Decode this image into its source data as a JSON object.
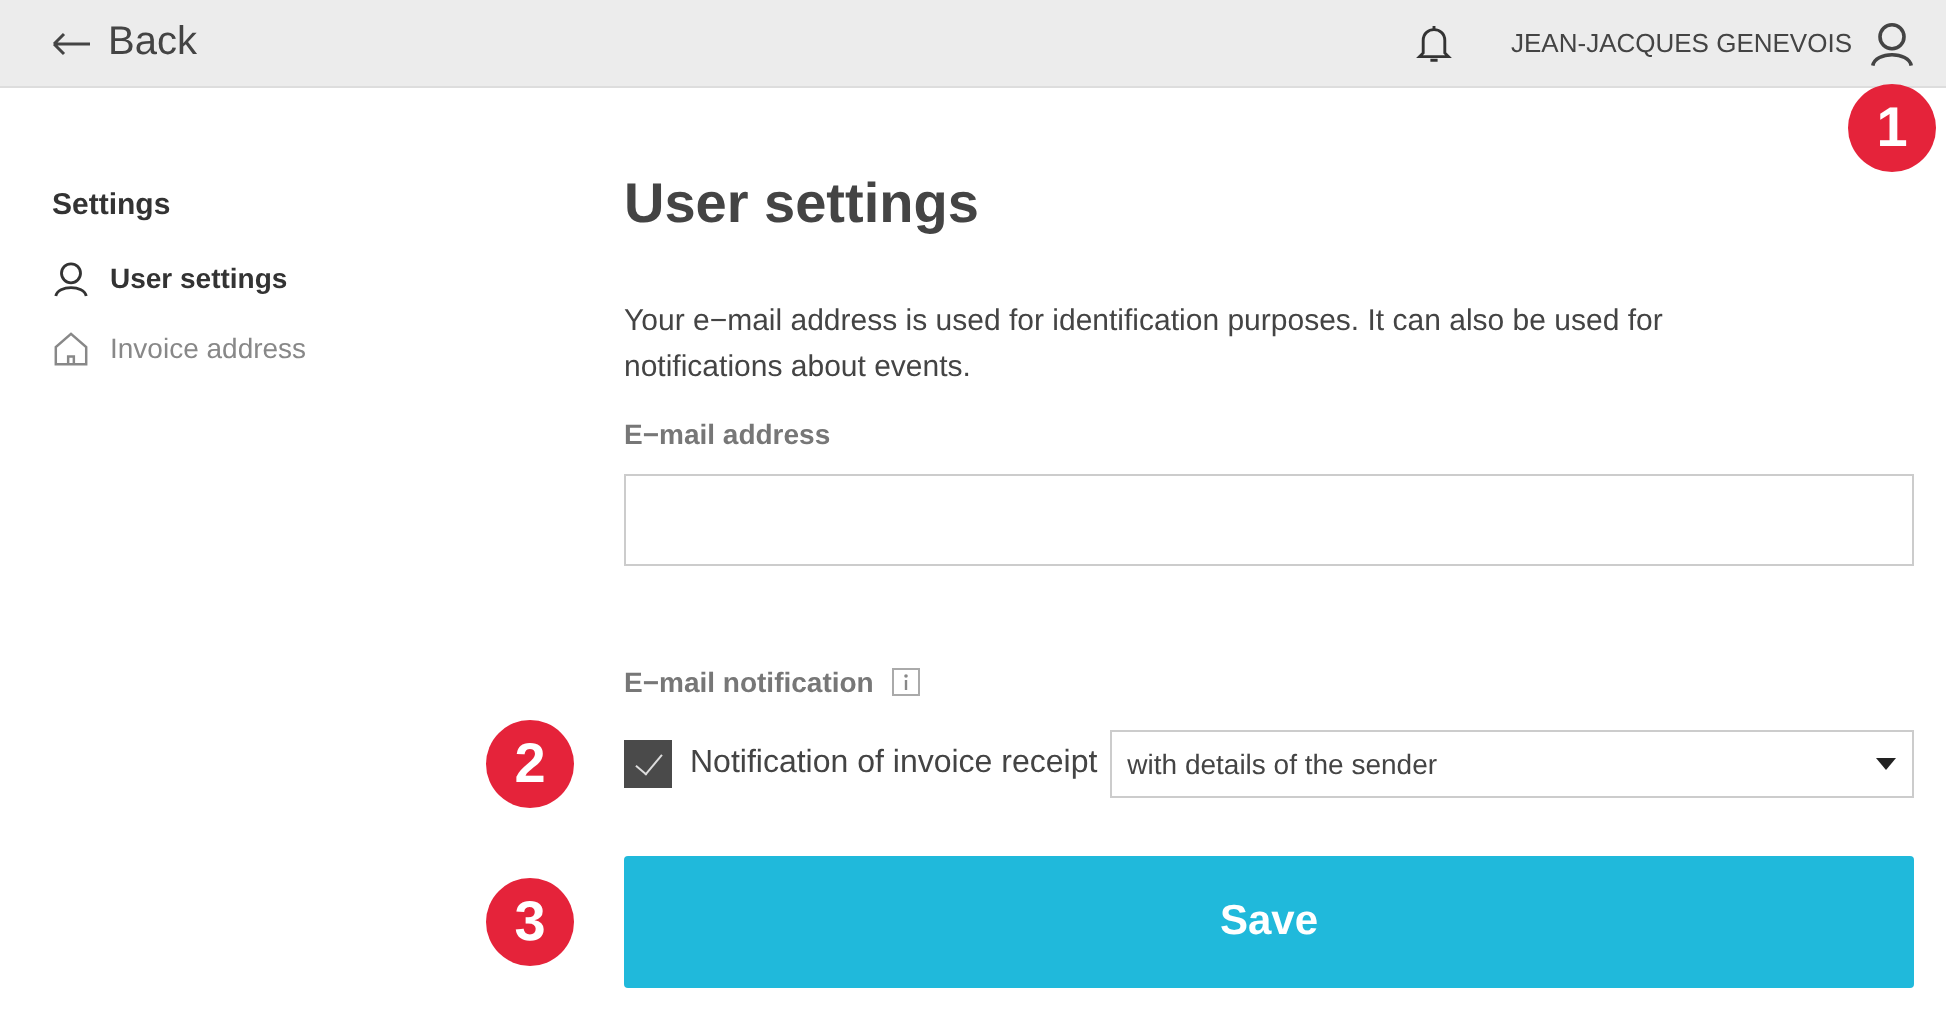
{
  "header": {
    "back_label": "Back",
    "user_name": "JEAN-JACQUES GENEVOIS"
  },
  "sidebar": {
    "title": "Settings",
    "items": [
      {
        "label": "User settings",
        "selected": true
      },
      {
        "label": "Invoice address",
        "selected": false
      }
    ]
  },
  "main": {
    "title": "User settings",
    "description": "Your e−mail address is used for identification purposes. It can also be used for notifications about events.",
    "email": {
      "label": "E−mail address"
    },
    "notification": {
      "label": "E−mail notification",
      "checkbox": {
        "label": "Notification of invoice receipt",
        "checked": true
      },
      "select": {
        "value": "with details of the sender"
      }
    },
    "save_label": "Save"
  },
  "callouts": [
    {
      "number": "1"
    },
    {
      "number": "2"
    },
    {
      "number": "3"
    }
  ]
}
